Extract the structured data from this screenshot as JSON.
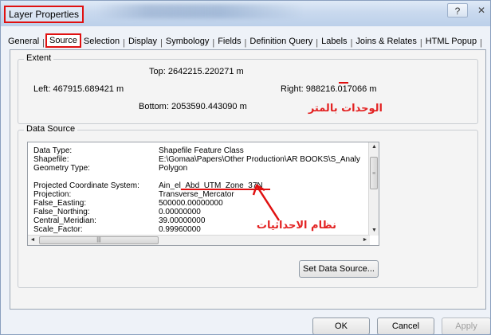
{
  "window": {
    "title": "Layer Properties",
    "help": "?",
    "close": "✕"
  },
  "tabs": [
    {
      "label": "General"
    },
    {
      "label": "Source"
    },
    {
      "label": "Selection"
    },
    {
      "label": "Display"
    },
    {
      "label": "Symbology"
    },
    {
      "label": "Fields"
    },
    {
      "label": "Definition Query"
    },
    {
      "label": "Labels"
    },
    {
      "label": "Joins & Relates"
    },
    {
      "label": "HTML Popup"
    }
  ],
  "extent": {
    "legend": "Extent",
    "top": "Top:  2642215.220271 m",
    "left": "Left:  467915.689421 m",
    "right": "Right:  988216.017066 m",
    "bottom": "Bottom:  2053590.443090 m",
    "annotation": "الوحدات بالمتر"
  },
  "datasource": {
    "legend": "Data Source",
    "rows": [
      {
        "key": "Data Type:",
        "value": "Shapefile Feature Class"
      },
      {
        "key": "Shapefile:",
        "value": "E:\\Gomaa\\Papers\\Other Production\\AR BOOKS\\S_Analy"
      },
      {
        "key": "Geometry Type:",
        "value": "Polygon"
      },
      {
        "key": "",
        "value": ""
      },
      {
        "key": "Projected Coordinate System:",
        "value": "Ain_el_Abd_UTM_Zone_37N"
      },
      {
        "key": "Projection:",
        "value": "Transverse_Mercator"
      },
      {
        "key": "False_Easting:",
        "value": "500000.00000000"
      },
      {
        "key": "False_Northing:",
        "value": "0.00000000"
      },
      {
        "key": "Central_Meridian:",
        "value": "39.00000000"
      },
      {
        "key": "Scale_Factor:",
        "value": "0.99960000"
      }
    ],
    "annotation": "نظام الاحداثيات",
    "set_button": "Set Data Source..."
  },
  "footer": {
    "ok": "OK",
    "cancel": "Cancel",
    "apply": "Apply"
  },
  "colors": {
    "annotation": "#e32222",
    "highlight": "#e01010"
  }
}
